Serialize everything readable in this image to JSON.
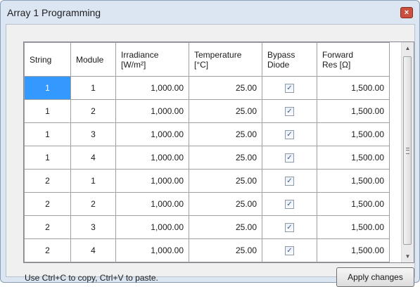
{
  "window": {
    "title": "Array 1 Programming",
    "close_symbol": "×"
  },
  "grid": {
    "columns": [
      {
        "line1": "String",
        "line2": ""
      },
      {
        "line1": "Module",
        "line2": ""
      },
      {
        "line1": "Irradiance",
        "line2": "[W/m²]"
      },
      {
        "line1": "Temperature",
        "line2": "[°C]"
      },
      {
        "line1": "Bypass",
        "line2": "Diode"
      },
      {
        "line1": "Forward",
        "line2": "Res [Ω]"
      }
    ],
    "rows": [
      {
        "string": "1",
        "module": "1",
        "irradiance": "1,000.00",
        "temperature": "25.00",
        "bypass_checked": true,
        "res": "1,500.00"
      },
      {
        "string": "1",
        "module": "2",
        "irradiance": "1,000.00",
        "temperature": "25.00",
        "bypass_checked": true,
        "res": "1,500.00"
      },
      {
        "string": "1",
        "module": "3",
        "irradiance": "1,000.00",
        "temperature": "25.00",
        "bypass_checked": true,
        "res": "1,500.00"
      },
      {
        "string": "1",
        "module": "4",
        "irradiance": "1,000.00",
        "temperature": "25.00",
        "bypass_checked": true,
        "res": "1,500.00"
      },
      {
        "string": "2",
        "module": "1",
        "irradiance": "1,000.00",
        "temperature": "25.00",
        "bypass_checked": true,
        "res": "1,500.00"
      },
      {
        "string": "2",
        "module": "2",
        "irradiance": "1,000.00",
        "temperature": "25.00",
        "bypass_checked": true,
        "res": "1,500.00"
      },
      {
        "string": "2",
        "module": "3",
        "irradiance": "1,000.00",
        "temperature": "25.00",
        "bypass_checked": true,
        "res": "1,500.00"
      },
      {
        "string": "2",
        "module": "4",
        "irradiance": "1,000.00",
        "temperature": "25.00",
        "bypass_checked": true,
        "res": "1,500.00"
      }
    ],
    "selected_cell": {
      "row": 0,
      "column": "string"
    }
  },
  "footer": {
    "hint": "Use Ctrl+C to copy, Ctrl+V to paste.",
    "apply_label": "Apply changes"
  },
  "colors": {
    "selection": "#3399ff",
    "close_button": "#c9503e"
  }
}
